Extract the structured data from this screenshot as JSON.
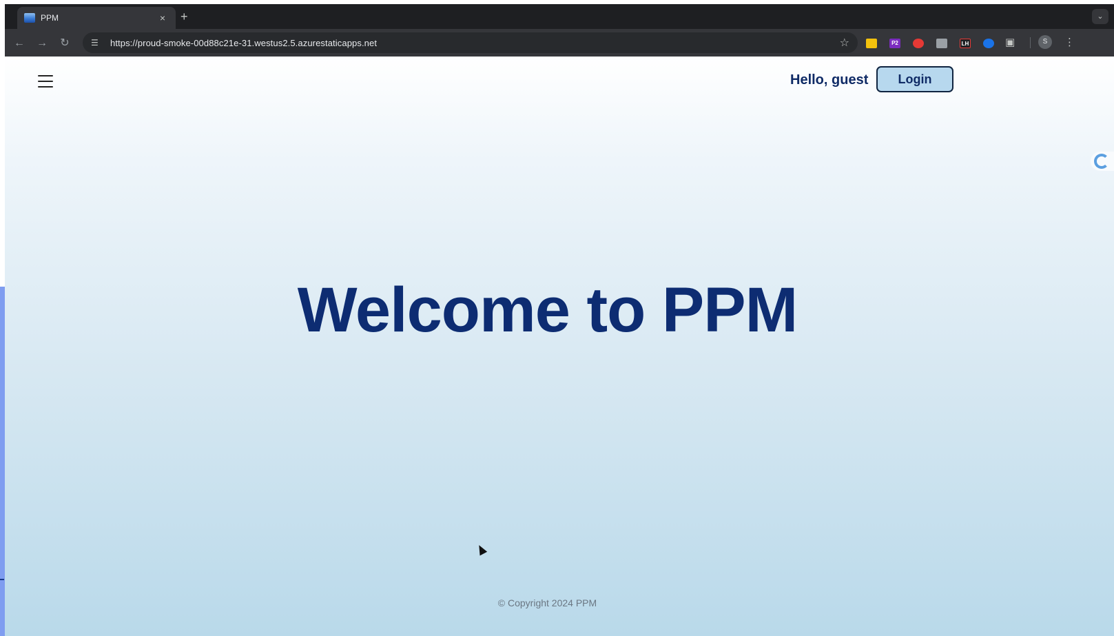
{
  "browser": {
    "tab_title": "PPM",
    "tab_close": "×",
    "new_tab": "+",
    "url": "https://proud-smoke-00d88c21e-31.westus2.5.azurestaticapps.net",
    "profile_initial": "S",
    "extensions": [
      {
        "name": "yellow-extension-icon",
        "color": "#f4c20d",
        "label": ""
      },
      {
        "name": "p2-extension-icon",
        "color": "#7b2cbf",
        "label": "P2"
      },
      {
        "name": "red-extension-icon",
        "color": "#e53935",
        "label": ""
      },
      {
        "name": "gray-extension-icon",
        "color": "#9aa0a6",
        "label": ""
      },
      {
        "name": "lh-extension-icon",
        "color": "#202124",
        "label": "LH"
      },
      {
        "name": "blue-extension-icon",
        "color": "#1a73e8",
        "label": ""
      }
    ]
  },
  "header": {
    "greeting": "Hello, guest",
    "login_label": "Login"
  },
  "main": {
    "headline": "Welcome to PPM"
  },
  "footer": {
    "copyright": "© Copyright 2024 PPM"
  },
  "colors": {
    "brand_navy": "#0d2c72",
    "button_bg": "#b7d8ee"
  }
}
